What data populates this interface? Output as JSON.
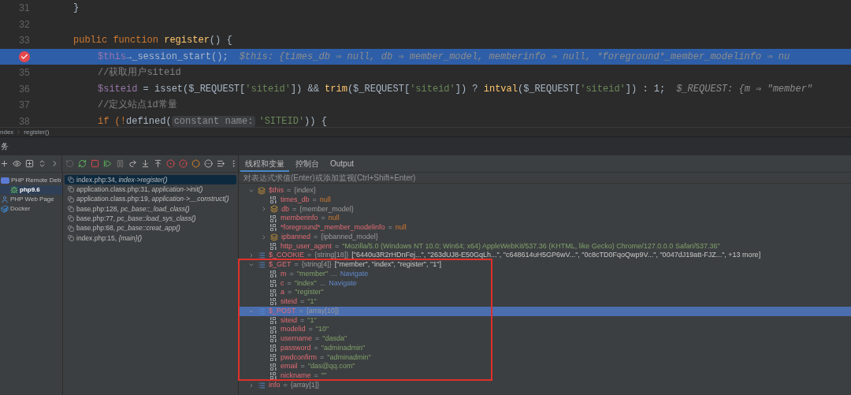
{
  "editor": {
    "lines": [
      {
        "number": "31",
        "nested": false,
        "current": false,
        "tokens": [
          {
            "text": "}",
            "kind": "plain"
          }
        ]
      },
      {
        "number": "32",
        "current": false
      },
      {
        "number": "33",
        "nested": false,
        "current": false,
        "tokens": [
          {
            "text": "public function ",
            "kind": "keyword"
          },
          {
            "text": "register",
            "kind": "func"
          },
          {
            "text": "() {",
            "kind": "plain"
          }
        ]
      },
      {
        "nested": true,
        "current": true,
        "tokens": [
          {
            "text": "$this",
            "kind": "var"
          },
          {
            "text": "→_session_start();",
            "kind": "plain"
          },
          {
            "text": "$this: {times_db ⇒ null, db ⇒ member_model, memberinfo ⇒ null, *foreground*_member_modelinfo ⇒ nu",
            "kind": "hint"
          }
        ]
      },
      {
        "number": "35",
        "nested": true,
        "current": false,
        "tokens": [
          {
            "text": "//获取用户siteid",
            "kind": "comment"
          }
        ]
      },
      {
        "number": "36",
        "nested": true,
        "current": false,
        "tokens": [
          {
            "text": "$siteid",
            "kind": "var"
          },
          {
            "text": " = ",
            "kind": "plain"
          },
          {
            "text": "isset",
            "kind": "plain"
          },
          {
            "text": "($_REQUEST[",
            "kind": "plain"
          },
          {
            "text": "'siteid'",
            "kind": "string"
          },
          {
            "text": "]) && ",
            "kind": "plain"
          },
          {
            "text": "trim",
            "kind": "func"
          },
          {
            "text": "($_REQUEST[",
            "kind": "plain"
          },
          {
            "text": "'siteid'",
            "kind": "string"
          },
          {
            "text": "]) ? ",
            "kind": "plain"
          },
          {
            "text": "intval",
            "kind": "func"
          },
          {
            "text": "($_REQUEST[",
            "kind": "plain"
          },
          {
            "text": "'siteid'",
            "kind": "string"
          },
          {
            "text": "]) : 1;",
            "kind": "plain"
          },
          {
            "text": "$_REQUEST: {m ⇒ \"member\"",
            "kind": "hint"
          }
        ]
      },
      {
        "number": "37",
        "nested": true,
        "current": false,
        "tokens": [
          {
            "text": "//定义站点id常量",
            "kind": "comment"
          }
        ]
      },
      {
        "number": "38",
        "nested": true,
        "current": false,
        "tokens": [
          {
            "text": "if (!",
            "kind": "keyword"
          },
          {
            "text": "defined",
            "kind": "plain"
          },
          {
            "text": "(",
            "kind": "plain"
          },
          {
            "text": "constant name:",
            "kind": "param"
          },
          {
            "text": "'SITEID'",
            "kind": "string"
          },
          {
            "text": ")) {",
            "kind": "plain"
          }
        ]
      }
    ]
  },
  "breadcrumb": [
    "ndex",
    "register()"
  ],
  "tool_window": {
    "title": "务"
  },
  "services": [
    {
      "label": "PHP Remote Deb",
      "kind": "php",
      "selected": false,
      "children": [
        {
          "label": "php9.6",
          "kind": "bug",
          "selected": true
        }
      ]
    },
    {
      "label": "PHP Web Page",
      "kind": "web",
      "selected": false
    },
    {
      "label": "Docker",
      "kind": "docker",
      "selected": false
    }
  ],
  "frames": [
    {
      "file": "index.php:34, ",
      "method": "index->register()",
      "selected": true
    },
    {
      "file": "application.class.php:31, ",
      "method": "application->init()",
      "selected": false
    },
    {
      "file": "application.class.php:19, ",
      "method": "application->__construct()",
      "selected": false
    },
    {
      "file": "base.php:128, ",
      "method": "pc_base::_load_class()",
      "selected": false
    },
    {
      "file": "base.php:77, ",
      "method": "pc_base::load_sys_class()",
      "selected": false
    },
    {
      "file": "base.php:68, ",
      "method": "pc_base::creat_app()",
      "selected": false
    },
    {
      "file": "index.php:15, ",
      "method": "{main}()",
      "selected": false
    }
  ],
  "tabs": [
    {
      "label": "线程和变量",
      "selected": true
    },
    {
      "label": "控制台",
      "selected": false
    },
    {
      "label": "Output",
      "selected": false
    }
  ],
  "evaluate": {
    "placeholder": "对表达式求值(Enter)或添加监视(Ctrl+Shift+Enter)"
  },
  "variables": [
    {
      "name": "$this",
      "op": "=",
      "kind": "object",
      "expanded": true,
      "selected": false,
      "value": {
        "text": "{index}",
        "kind": "type"
      },
      "children": [
        {
          "name": "times_db",
          "op": "=",
          "kind": "scalar",
          "selected": false,
          "value": {
            "text": "null",
            "kind": "null"
          }
        },
        {
          "name": "db",
          "op": "=",
          "kind": "object",
          "expanded": false,
          "selected": false,
          "value": {
            "text": "{member_model}",
            "kind": "type"
          }
        },
        {
          "name": "memberinfo",
          "op": "=",
          "kind": "scalar",
          "selected": false,
          "value": {
            "text": "null",
            "kind": "null"
          }
        },
        {
          "name": "*foreground*_member_modelinfo",
          "op": "=",
          "kind": "scalar",
          "selected": false,
          "value": {
            "text": "null",
            "kind": "null"
          }
        },
        {
          "name": "ipbanned",
          "op": "=",
          "kind": "object",
          "expanded": false,
          "selected": false,
          "value": {
            "text": "{ipbanned_model}",
            "kind": "type"
          }
        },
        {
          "name": "http_user_agent",
          "op": "=",
          "kind": "scalar",
          "selected": false,
          "value": {
            "text": "\"Mozilla/5.0 (Windows NT 10.0; Win64; x64) AppleWebKit/537.36 (KHTML, like Gecko) Chrome/127.0.0.0 Safari/537.36\"",
            "kind": "string"
          }
        }
      ]
    },
    {
      "name": "$_COOKIE",
      "op": "=",
      "kind": "array",
      "expanded": false,
      "selected": false,
      "value": {
        "text": "{string[18]}",
        "kind": "type"
      },
      "summary": "[\"6440u3R2rHDnFej...\", \"263dUJ8-E50GqLh...\", \"c648614uH5GP6wV...\", \"0c8cTD0FqoQwp9V...\", \"0047dJ19att-FJZ...\", +13 more]"
    },
    {
      "name": "$_GET",
      "op": "=",
      "kind": "array",
      "expanded": true,
      "selected": false,
      "value": {
        "text": "{string[4]}",
        "kind": "type"
      },
      "summary": "[\"member\", \"index\", \"register\", \"1\"]",
      "children": [
        {
          "name": "m",
          "op": "=",
          "kind": "scalar",
          "selected": false,
          "value": {
            "text": "\"member\"",
            "kind": "string"
          },
          "more": "...",
          "link": "Navigate"
        },
        {
          "name": "c",
          "op": "=",
          "kind": "scalar",
          "selected": false,
          "value": {
            "text": "\"index\"",
            "kind": "string"
          },
          "more": "...",
          "link": "Navigate"
        },
        {
          "name": "a",
          "op": "=",
          "kind": "scalar",
          "selected": false,
          "value": {
            "text": "\"register\"",
            "kind": "string"
          }
        },
        {
          "name": "siteid",
          "op": "=",
          "kind": "scalar",
          "selected": false,
          "value": {
            "text": "\"1\"",
            "kind": "string"
          }
        }
      ]
    },
    {
      "name": "$_POST",
      "op": "=",
      "kind": "array",
      "expanded": true,
      "selected": true,
      "value": {
        "text": "{array[10]}",
        "kind": "type"
      },
      "children": [
        {
          "name": "siteid",
          "op": "=",
          "kind": "scalar",
          "selected": false,
          "value": {
            "text": "\"1\"",
            "kind": "string"
          }
        },
        {
          "name": "modelid",
          "op": "=",
          "kind": "scalar",
          "selected": false,
          "value": {
            "text": "\"10\"",
            "kind": "string"
          }
        },
        {
          "name": "username",
          "op": "=",
          "kind": "scalar",
          "selected": false,
          "value": {
            "text": "\"dasda\"",
            "kind": "string"
          }
        },
        {
          "name": "password",
          "op": "=",
          "kind": "scalar",
          "selected": false,
          "value": {
            "text": "\"adminadmin\"",
            "kind": "string"
          }
        },
        {
          "name": "pwdconfirm",
          "op": "=",
          "kind": "scalar",
          "selected": false,
          "value": {
            "text": "\"adminadmin\"",
            "kind": "string"
          }
        },
        {
          "name": "email",
          "op": "=",
          "kind": "scalar",
          "selected": false,
          "value": {
            "text": "\"das@qq.com\"",
            "kind": "string"
          }
        },
        {
          "name": "nickname",
          "op": "=",
          "kind": "scalar",
          "selected": false,
          "value": {
            "text": "\"\"",
            "kind": "string"
          }
        }
      ]
    },
    {
      "name": "info",
      "op": "=",
      "kind": "array",
      "expanded": false,
      "selected": false,
      "value": {
        "text": "{array[1]}",
        "kind": "type"
      }
    }
  ]
}
